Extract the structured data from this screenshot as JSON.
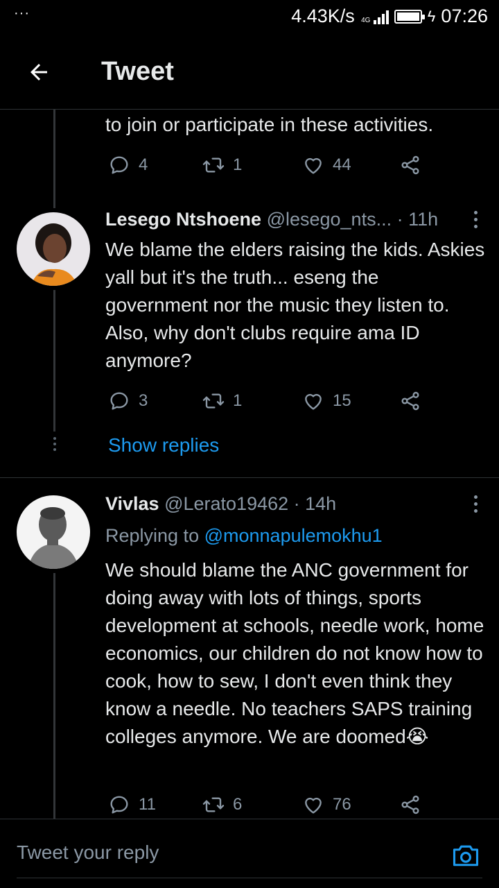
{
  "status_bar": {
    "dots": "···",
    "net_speed": "4.43K/s",
    "network": "4G",
    "time": "07:26"
  },
  "header": {
    "title": "Tweet"
  },
  "tweets": [
    {
      "text_tail": "to join or participate in these activities.",
      "replies": "4",
      "retweets": "1",
      "likes": "44"
    },
    {
      "name": "Lesego Ntshoene",
      "handle": "@lesego_nts...",
      "time": "· 11h",
      "text": "We blame the elders raising the kids. Askies yall but it's the truth... eseng the government nor the music they listen to. Also, why don't clubs require ama ID anymore?",
      "replies": "3",
      "retweets": "1",
      "likes": "15",
      "show_replies": "Show replies"
    },
    {
      "name": "Vivlas",
      "handle": "@Lerato19462",
      "time": "· 14h",
      "replying_prefix": "Replying to",
      "replying_to": "@monnapulemokhu1",
      "text": "We should blame the ANC government for doing away with lots of things, sports development at schools, needle work, home economics, our children do not know how to cook, how to sew, I don't even think they know a needle. No teachers  SAPS training colleges anymore. We are doomed😭",
      "replies": "11",
      "retweets": "6",
      "likes": "76"
    }
  ],
  "reply_bar": {
    "placeholder": "Tweet your reply"
  },
  "colors": {
    "background": "#000000",
    "text": "#e7e9ea",
    "muted": "#8b98a5",
    "link": "#1d9bf0",
    "divider": "#2f3336"
  }
}
